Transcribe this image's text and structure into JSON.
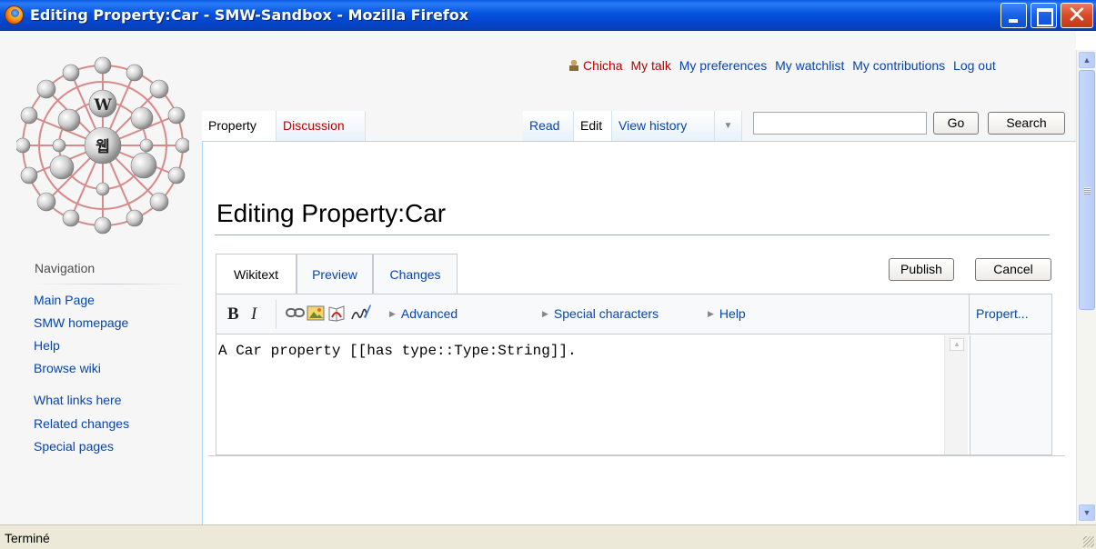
{
  "window": {
    "title": "Editing Property:Car - SMW-Sandbox - Mozilla Firefox",
    "status": "Terminé"
  },
  "personal": {
    "username": "Chicha",
    "talk": "My talk",
    "preferences": "My preferences",
    "watchlist": "My watchlist",
    "contributions": "My contributions",
    "logout": "Log out"
  },
  "tabs": {
    "property": "Property",
    "discussion": "Discussion",
    "read": "Read",
    "edit": "Edit",
    "history": "View history"
  },
  "search": {
    "value": "",
    "go": "Go",
    "search": "Search"
  },
  "page": {
    "heading": "Editing Property:Car"
  },
  "navigation": {
    "heading": "Navigation",
    "items": [
      "Main Page",
      "SMW homepage",
      "Help",
      "Browse wiki"
    ],
    "tools": [
      "What links here",
      "Related changes",
      "Special pages"
    ]
  },
  "editor": {
    "tabs": [
      "Wikitext",
      "Preview",
      "Changes"
    ],
    "publish": "Publish",
    "cancel": "Cancel",
    "bold": "B",
    "italic": "I",
    "menus": [
      "Advanced",
      "Special characters",
      "Help"
    ],
    "property_panel": "Propert...",
    "content": "A Car property [[has type::Type:String]]."
  },
  "colors": {
    "link": "#0645ad",
    "redlink": "#ba0000",
    "titlebar": "#0553e0"
  },
  "icons": {
    "window_buttons": [
      "minimize-icon",
      "maximize-icon",
      "close-icon"
    ],
    "toolbar": [
      "link-icon",
      "image-icon",
      "pdf-icon",
      "signature-icon"
    ]
  }
}
